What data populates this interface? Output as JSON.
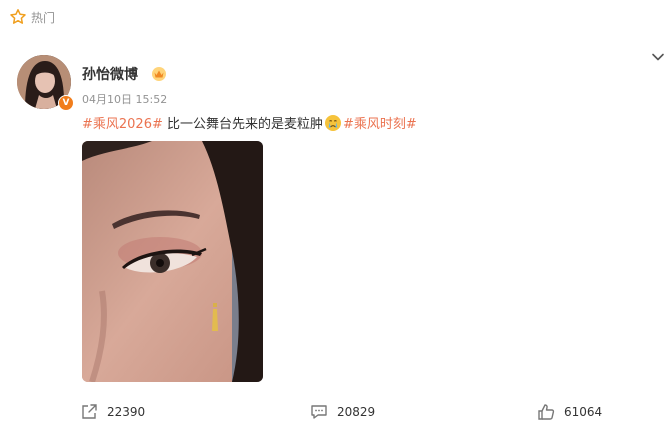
{
  "hot": {
    "label": "热门"
  },
  "post": {
    "author": "孙怡微博",
    "timestamp": "04月10日 15:52",
    "tag1": "#乘风2026#",
    "text": " 比一公舞台先来的是麦粒肿",
    "tag2": "#乘风时刻#",
    "verified_badge": "V"
  },
  "actions": {
    "forward_count": "22390",
    "comment_count": "20829",
    "like_count": "61064"
  },
  "icons": {
    "hot": "star-icon",
    "more": "chevron-down-icon",
    "vip": "vip-badge-icon",
    "emoji": "crying-face-emoji",
    "forward": "forward-icon",
    "comment": "comment-icon",
    "like": "thumbs-up-icon"
  },
  "colors": {
    "accent": "#eb7350",
    "muted": "#939393",
    "badge": "#f17d1b"
  }
}
